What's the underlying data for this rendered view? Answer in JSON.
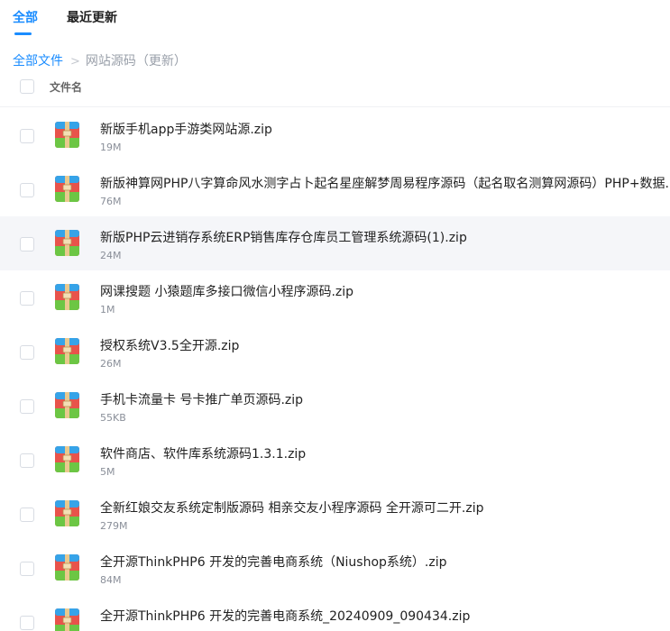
{
  "tabs": [
    {
      "label": "全部",
      "active": true
    },
    {
      "label": "最近更新",
      "active": false
    }
  ],
  "breadcrumb": {
    "root": "全部文件",
    "current": "网站源码（更新）"
  },
  "list_header": {
    "name_label": "文件名"
  },
  "files": [
    {
      "name": "新版手机app手游类网站源.zip",
      "size": "19M"
    },
    {
      "name": "新版神算网PHP八字算命风水测字占卜起名星座解梦周易程序源码（起名取名测算网源码）PHP+数据.r",
      "size": "76M"
    },
    {
      "name": "新版PHP云进销存系统ERP销售库存仓库员工管理系统源码(1).zip",
      "size": "24M"
    },
    {
      "name": "网课搜题 小猿题库多接口微信小程序源码.zip",
      "size": "1M"
    },
    {
      "name": "授权系统V3.5全开源.zip",
      "size": "26M"
    },
    {
      "name": "手机卡流量卡 号卡推广单页源码.zip",
      "size": "55KB"
    },
    {
      "name": "软件商店、软件库系统源码1.3.1.zip",
      "size": "5M"
    },
    {
      "name": "全新红娘交友系统定制版源码 相亲交友小程序源码 全开源可二开.zip",
      "size": "279M"
    },
    {
      "name": "全开源ThinkPHP6 开发的完善电商系统（Niushop系统）.zip",
      "size": "84M"
    },
    {
      "name": "全开源ThinkPHP6 开发的完善电商系统_20240909_090434.zip",
      "size": ""
    }
  ],
  "colors": {
    "accent": "#1a8cff",
    "row_highlight": "#f5f6f9",
    "zip_green": "#6cc644",
    "zip_red": "#e8534b",
    "zip_blue": "#36a3e8",
    "zip_tan": "#e9c98e"
  }
}
